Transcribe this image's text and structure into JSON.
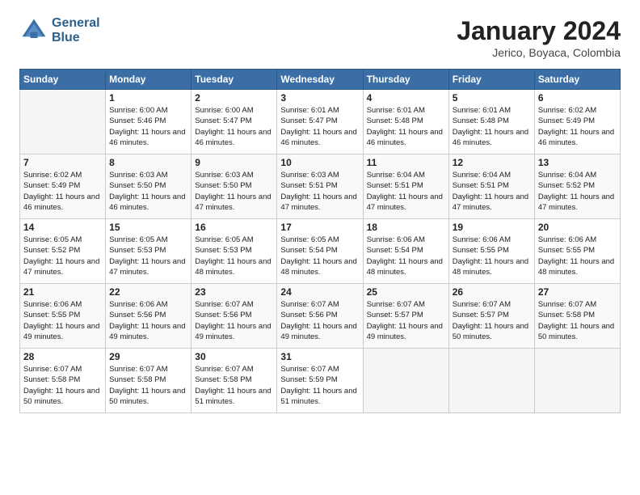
{
  "header": {
    "logo_line1": "General",
    "logo_line2": "Blue",
    "title": "January 2024",
    "subtitle": "Jerico, Boyaca, Colombia"
  },
  "days_of_week": [
    "Sunday",
    "Monday",
    "Tuesday",
    "Wednesday",
    "Thursday",
    "Friday",
    "Saturday"
  ],
  "weeks": [
    [
      {
        "day": "",
        "info": ""
      },
      {
        "day": "1",
        "info": "Sunrise: 6:00 AM\nSunset: 5:46 PM\nDaylight: 11 hours\nand 46 minutes."
      },
      {
        "day": "2",
        "info": "Sunrise: 6:00 AM\nSunset: 5:47 PM\nDaylight: 11 hours\nand 46 minutes."
      },
      {
        "day": "3",
        "info": "Sunrise: 6:01 AM\nSunset: 5:47 PM\nDaylight: 11 hours\nand 46 minutes."
      },
      {
        "day": "4",
        "info": "Sunrise: 6:01 AM\nSunset: 5:48 PM\nDaylight: 11 hours\nand 46 minutes."
      },
      {
        "day": "5",
        "info": "Sunrise: 6:01 AM\nSunset: 5:48 PM\nDaylight: 11 hours\nand 46 minutes."
      },
      {
        "day": "6",
        "info": "Sunrise: 6:02 AM\nSunset: 5:49 PM\nDaylight: 11 hours\nand 46 minutes."
      }
    ],
    [
      {
        "day": "7",
        "info": "Sunrise: 6:02 AM\nSunset: 5:49 PM\nDaylight: 11 hours\nand 46 minutes."
      },
      {
        "day": "8",
        "info": "Sunrise: 6:03 AM\nSunset: 5:50 PM\nDaylight: 11 hours\nand 46 minutes."
      },
      {
        "day": "9",
        "info": "Sunrise: 6:03 AM\nSunset: 5:50 PM\nDaylight: 11 hours\nand 47 minutes."
      },
      {
        "day": "10",
        "info": "Sunrise: 6:03 AM\nSunset: 5:51 PM\nDaylight: 11 hours\nand 47 minutes."
      },
      {
        "day": "11",
        "info": "Sunrise: 6:04 AM\nSunset: 5:51 PM\nDaylight: 11 hours\nand 47 minutes."
      },
      {
        "day": "12",
        "info": "Sunrise: 6:04 AM\nSunset: 5:51 PM\nDaylight: 11 hours\nand 47 minutes."
      },
      {
        "day": "13",
        "info": "Sunrise: 6:04 AM\nSunset: 5:52 PM\nDaylight: 11 hours\nand 47 minutes."
      }
    ],
    [
      {
        "day": "14",
        "info": "Sunrise: 6:05 AM\nSunset: 5:52 PM\nDaylight: 11 hours\nand 47 minutes."
      },
      {
        "day": "15",
        "info": "Sunrise: 6:05 AM\nSunset: 5:53 PM\nDaylight: 11 hours\nand 47 minutes."
      },
      {
        "day": "16",
        "info": "Sunrise: 6:05 AM\nSunset: 5:53 PM\nDaylight: 11 hours\nand 48 minutes."
      },
      {
        "day": "17",
        "info": "Sunrise: 6:05 AM\nSunset: 5:54 PM\nDaylight: 11 hours\nand 48 minutes."
      },
      {
        "day": "18",
        "info": "Sunrise: 6:06 AM\nSunset: 5:54 PM\nDaylight: 11 hours\nand 48 minutes."
      },
      {
        "day": "19",
        "info": "Sunrise: 6:06 AM\nSunset: 5:55 PM\nDaylight: 11 hours\nand 48 minutes."
      },
      {
        "day": "20",
        "info": "Sunrise: 6:06 AM\nSunset: 5:55 PM\nDaylight: 11 hours\nand 48 minutes."
      }
    ],
    [
      {
        "day": "21",
        "info": "Sunrise: 6:06 AM\nSunset: 5:55 PM\nDaylight: 11 hours\nand 49 minutes."
      },
      {
        "day": "22",
        "info": "Sunrise: 6:06 AM\nSunset: 5:56 PM\nDaylight: 11 hours\nand 49 minutes."
      },
      {
        "day": "23",
        "info": "Sunrise: 6:07 AM\nSunset: 5:56 PM\nDaylight: 11 hours\nand 49 minutes."
      },
      {
        "day": "24",
        "info": "Sunrise: 6:07 AM\nSunset: 5:56 PM\nDaylight: 11 hours\nand 49 minutes."
      },
      {
        "day": "25",
        "info": "Sunrise: 6:07 AM\nSunset: 5:57 PM\nDaylight: 11 hours\nand 49 minutes."
      },
      {
        "day": "26",
        "info": "Sunrise: 6:07 AM\nSunset: 5:57 PM\nDaylight: 11 hours\nand 50 minutes."
      },
      {
        "day": "27",
        "info": "Sunrise: 6:07 AM\nSunset: 5:58 PM\nDaylight: 11 hours\nand 50 minutes."
      }
    ],
    [
      {
        "day": "28",
        "info": "Sunrise: 6:07 AM\nSunset: 5:58 PM\nDaylight: 11 hours\nand 50 minutes."
      },
      {
        "day": "29",
        "info": "Sunrise: 6:07 AM\nSunset: 5:58 PM\nDaylight: 11 hours\nand 50 minutes."
      },
      {
        "day": "30",
        "info": "Sunrise: 6:07 AM\nSunset: 5:58 PM\nDaylight: 11 hours\nand 51 minutes."
      },
      {
        "day": "31",
        "info": "Sunrise: 6:07 AM\nSunset: 5:59 PM\nDaylight: 11 hours\nand 51 minutes."
      },
      {
        "day": "",
        "info": ""
      },
      {
        "day": "",
        "info": ""
      },
      {
        "day": "",
        "info": ""
      }
    ]
  ]
}
